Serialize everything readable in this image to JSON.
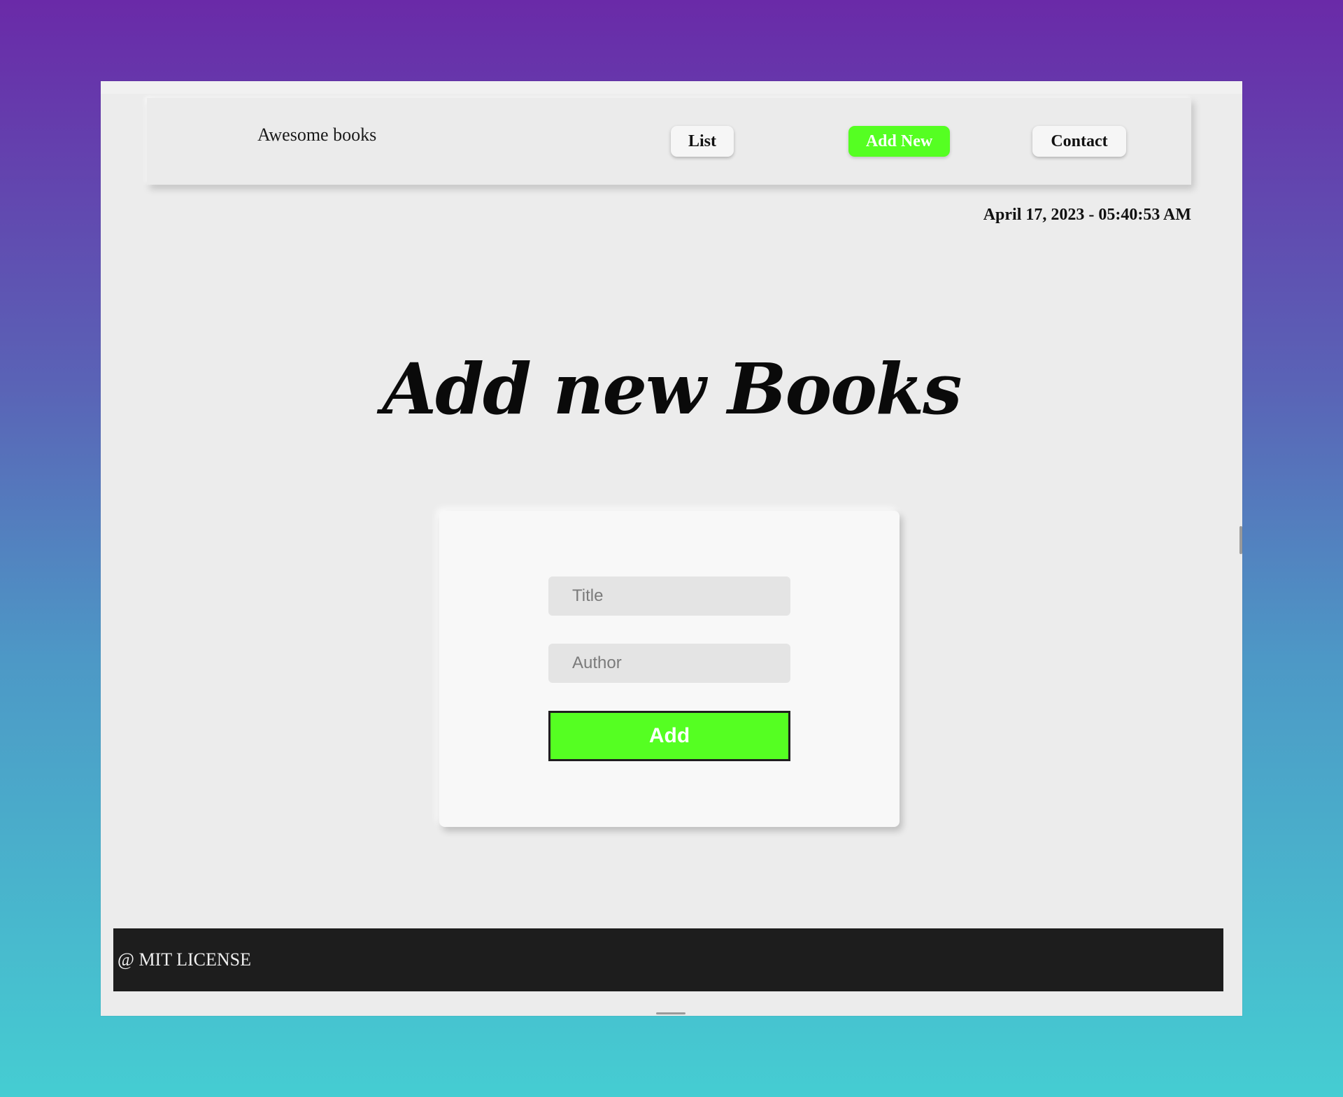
{
  "navbar": {
    "brand": "Awesome books",
    "links": [
      {
        "label": "List",
        "active": false
      },
      {
        "label": "Add New",
        "active": true
      },
      {
        "label": "Contact",
        "active": false
      }
    ]
  },
  "datetime": "April 17, 2023 - 05:40:53 AM",
  "main": {
    "title": "Add new Books",
    "form": {
      "title_placeholder": "Title",
      "title_value": "",
      "author_placeholder": "Author",
      "author_value": "",
      "submit_label": "Add"
    }
  },
  "footer": {
    "text": "@ MIT LICENSE"
  },
  "colors": {
    "accent": "#55ff22",
    "footer_bg": "#1d1d1d",
    "page_bg": "#ececec",
    "gradient_top": "#6a2aa8",
    "gradient_bottom": "#45cdd2"
  }
}
